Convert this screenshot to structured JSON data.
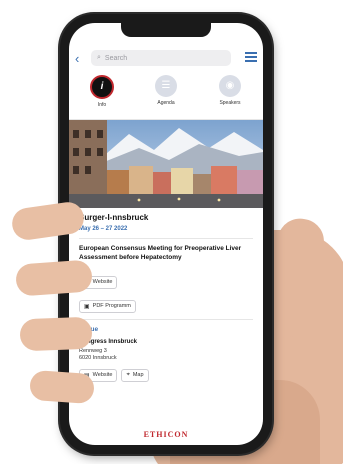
{
  "search": {
    "placeholder": "Search"
  },
  "tabs": [
    {
      "label": "Info"
    },
    {
      "label": "Agenda"
    },
    {
      "label": "Speakers"
    }
  ],
  "event": {
    "city": "Surger-I-nnsbruck",
    "dates": "May 26 – 27 2022",
    "name": "European Consensus Meeting for Preoperative Liver Assessment before Hepatectomy",
    "website_label": "Website",
    "pdf_label": "PDF Programm"
  },
  "venue": {
    "section_title": "Venue",
    "name": "Congress Innsbruck",
    "address_line1": "Rennweg 3",
    "address_line2": "6020 Innsbruck",
    "website_label": "Website",
    "map_label": "Map"
  },
  "brand": {
    "logo": "ETHICON"
  },
  "colors": {
    "accent": "#3a6fb0",
    "brand": "#c0282e"
  },
  "icons": {
    "back": "chevron-left-icon",
    "search": "search-icon",
    "menu": "hamburger-menu-icon",
    "info": "info-icon",
    "agenda": "agenda-icon",
    "speakers": "speakers-icon",
    "website": "website-icon",
    "pdf": "pdf-icon",
    "map": "map-icon"
  }
}
